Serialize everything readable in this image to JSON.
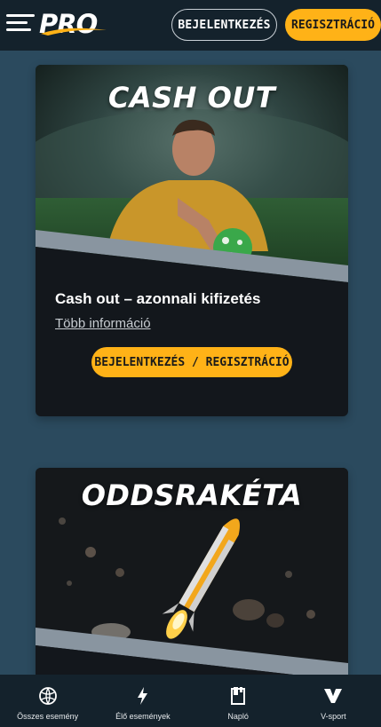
{
  "header": {
    "logo_text": "PRO",
    "login_label": "BEJELENTKEZÉS",
    "register_label": "REGISZTRÁCIÓ"
  },
  "cards": [
    {
      "title": "CASH OUT",
      "heading": "Cash out – azonnali kifizetés",
      "link": "Több információ",
      "cta": "BEJELENTKEZÉS / REGISZTRÁCIÓ"
    },
    {
      "title": "ODDSRAKÉTA"
    }
  ],
  "bottom_nav": {
    "items": [
      {
        "label": "Összes esemény",
        "icon": "ball-icon"
      },
      {
        "label": "Élő események",
        "icon": "lightning-icon"
      },
      {
        "label": "Napló",
        "icon": "ticket-icon"
      },
      {
        "label": "V-sport",
        "icon": "v-sport-icon"
      }
    ]
  },
  "colors": {
    "background": "#2b4a5e",
    "header": "#14222c",
    "accent": "#ffb217",
    "card": "#13171c"
  }
}
